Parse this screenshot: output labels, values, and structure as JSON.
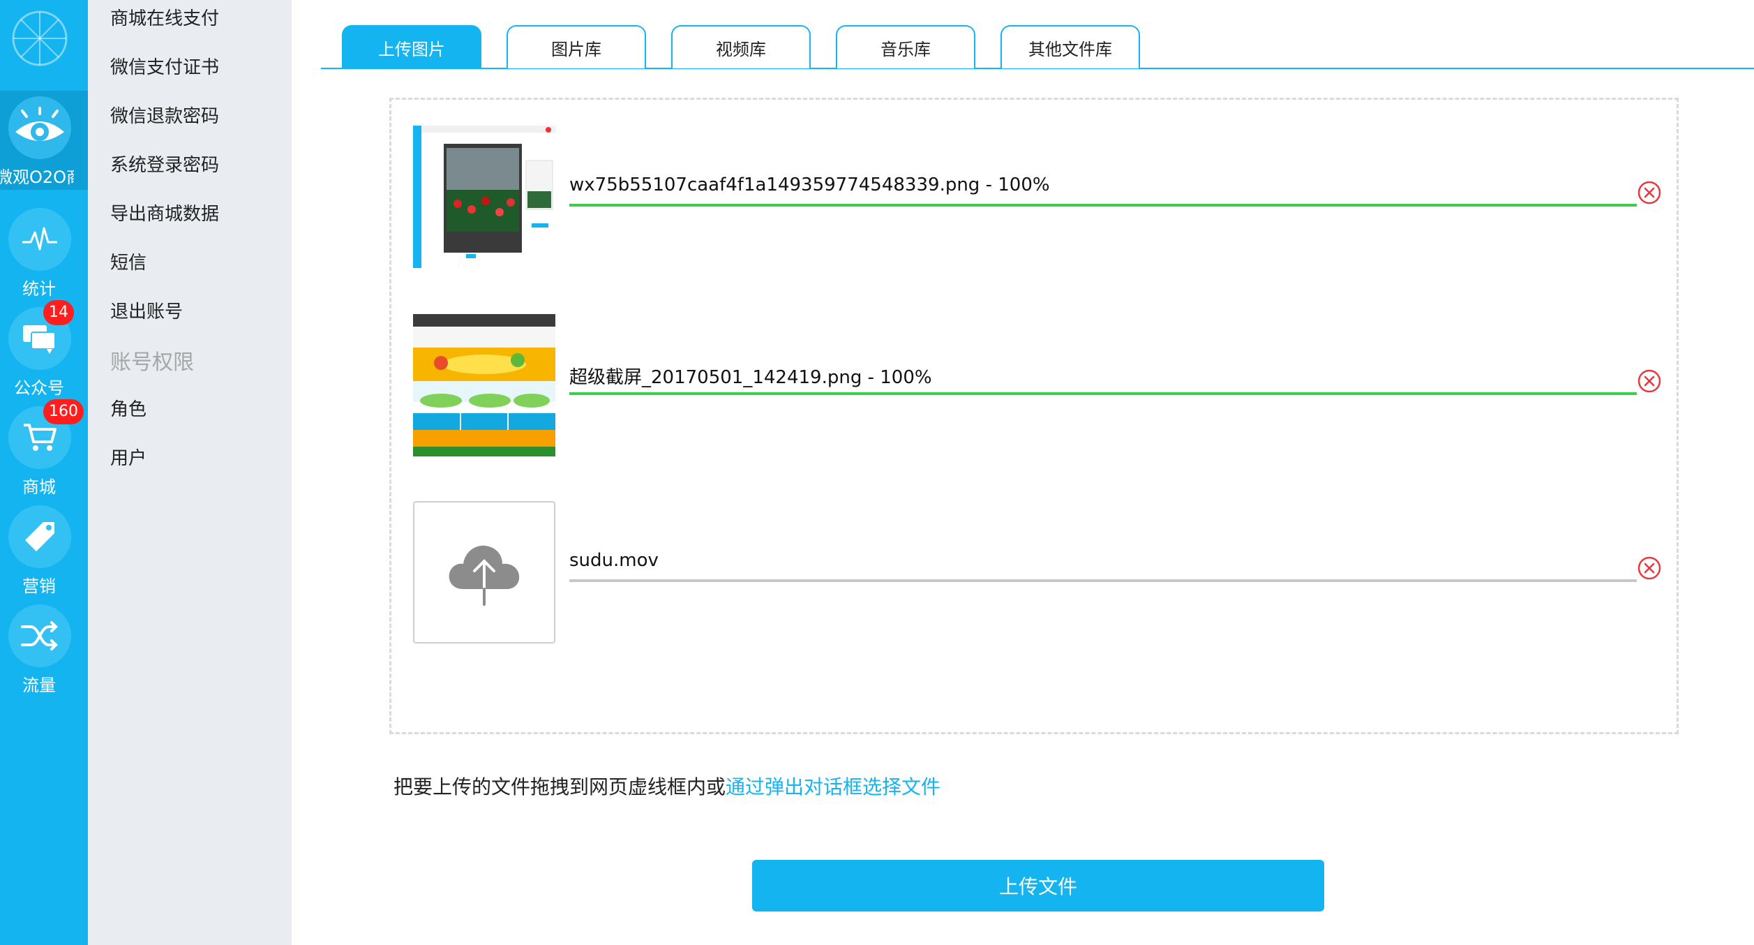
{
  "rail": {
    "items": [
      {
        "label": "微观O2O商...",
        "icon": "eye-icon",
        "active": true
      },
      {
        "label": "统计",
        "icon": "pulse-icon"
      },
      {
        "label": "公众号",
        "icon": "chat-icon",
        "badge": "14"
      },
      {
        "label": "商城",
        "icon": "cart-icon",
        "badge": "160"
      },
      {
        "label": "营销",
        "icon": "tag-icon"
      },
      {
        "label": "流量",
        "icon": "shuffle-icon"
      }
    ]
  },
  "menu": {
    "items": [
      "商城在线支付",
      "微信支付证书",
      "微信退款密码",
      "系统登录密码",
      "导出商城数据",
      "短信",
      "退出账号"
    ],
    "group_title": "账号权限",
    "group_items": [
      "角色",
      "用户"
    ]
  },
  "tabs": [
    {
      "label": "上传图片",
      "active": true
    },
    {
      "label": "图片库"
    },
    {
      "label": "视频库"
    },
    {
      "label": "音乐库"
    },
    {
      "label": "其他文件库"
    }
  ],
  "files": [
    {
      "name": "wx75b55107caaf4f1a149359774548339.png",
      "progress_text": " - 100%",
      "progress": 1.0
    },
    {
      "name": "超级截屏_20170501_142419.png",
      "progress_text": " - 100%",
      "progress": 1.0
    },
    {
      "name": "sudu.mov",
      "progress_text": "",
      "progress": 0.0
    }
  ],
  "hint": {
    "text": "把要上传的文件拖拽到网页虚线框内或",
    "link": "通过弹出对话框选择文件"
  },
  "upload_button": "上传文件",
  "colors": {
    "accent": "#14b4f0",
    "progress": "#3ecf4a",
    "badge": "#ff1e1e",
    "remove": "#e8383d"
  }
}
